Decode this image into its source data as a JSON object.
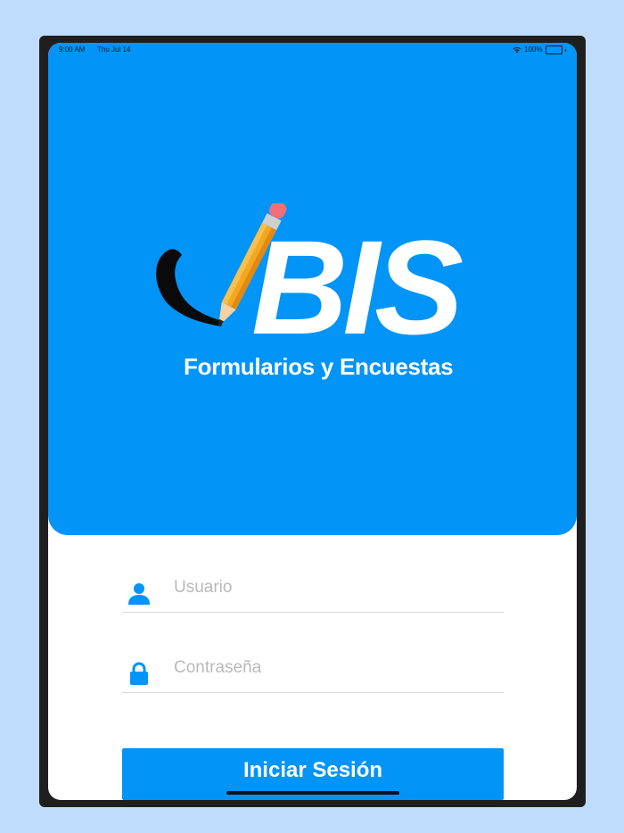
{
  "status_bar": {
    "time": "9:00 AM",
    "date": "Thu Jul 14",
    "battery": "100%",
    "icons": [
      "wifi-icon",
      "battery-icon"
    ]
  },
  "logo": {
    "wordmark": "BIS",
    "subtitle": "Formularios y Encuestas"
  },
  "form": {
    "username_placeholder": "Usuario",
    "username_value": "",
    "password_placeholder": "Contraseña",
    "password_value": "",
    "submit_label": "Iniciar Sesión"
  },
  "colors": {
    "page_background": "#bfdcfd",
    "primary": "#0294f7",
    "device_frame": "#1f1f1f",
    "placeholder": "#b9b9b9",
    "divider": "#d9d9d9",
    "pencil_body": "#f5a623",
    "pencil_eraser": "#f06e7b"
  }
}
